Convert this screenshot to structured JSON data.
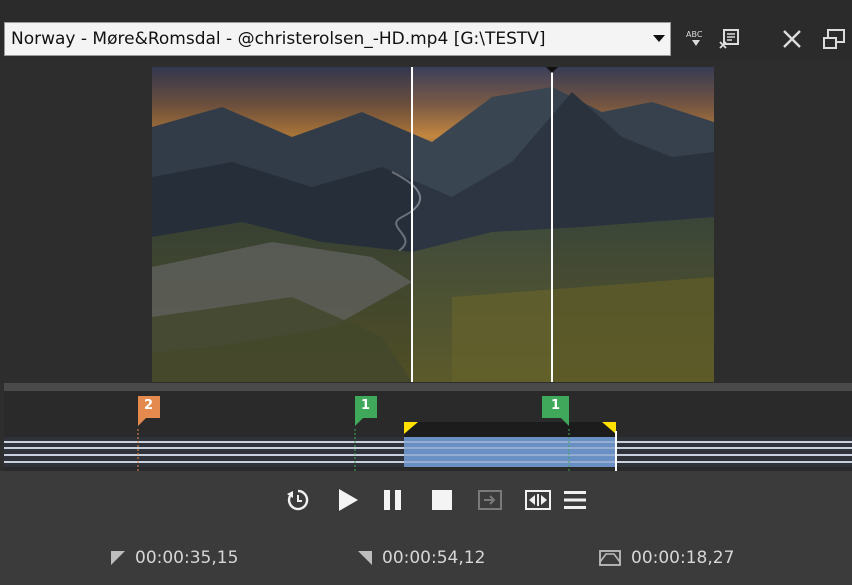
{
  "toolbar": {
    "file_label": "Norway - Møre&Romsdal - @christerolsen_-HD.mp4   [G:\\TESTV]",
    "icons": [
      "spellcheck-icon",
      "properties-icon",
      "close-icon",
      "window-icon"
    ]
  },
  "timeline": {
    "markers": [
      {
        "label": "2",
        "color": "#e58a4e"
      },
      {
        "label": "1",
        "color": "#3fa85a"
      },
      {
        "label": "1",
        "color": "#3fa85a"
      }
    ],
    "selection_color": "#6a8fc4"
  },
  "transport": {
    "icons": [
      "loop-icon",
      "play-icon",
      "pause-icon",
      "stop-icon",
      "next-frame-icon",
      "fit-selection-icon",
      "menu-icon"
    ]
  },
  "timecodes": {
    "in": "00:00:35,15",
    "out": "00:00:54,12",
    "length": "00:00:18,27"
  }
}
